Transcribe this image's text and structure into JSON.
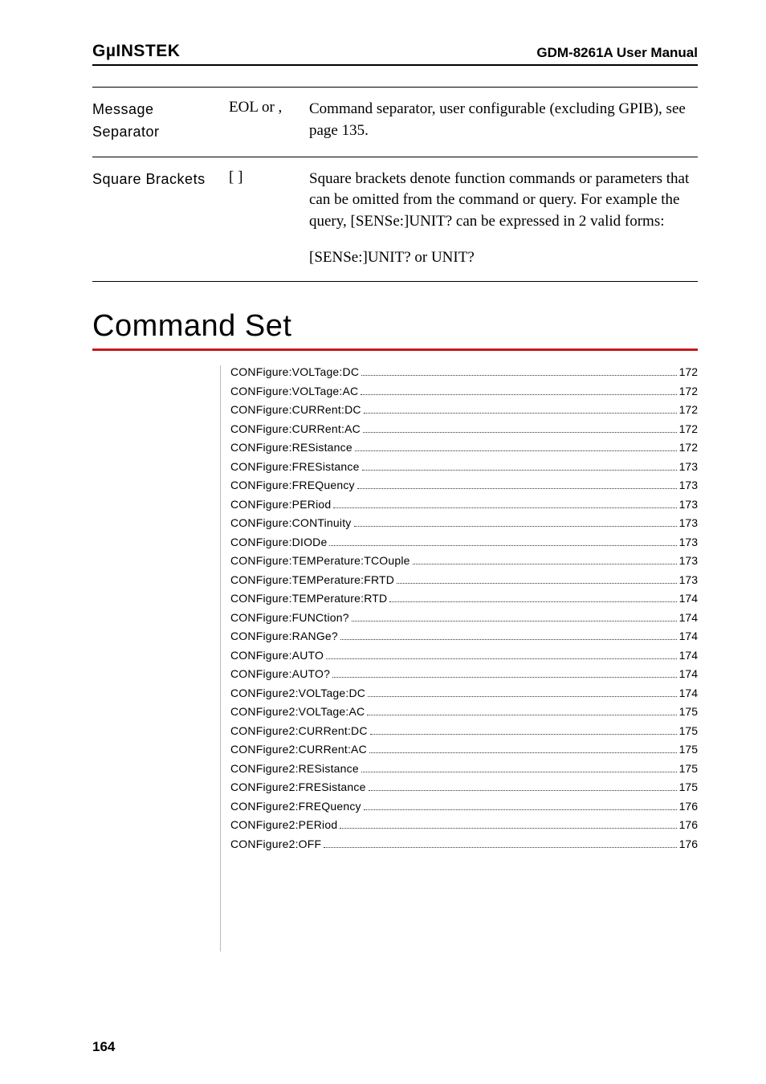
{
  "header": {
    "logo": "GµINSTEK",
    "manual": "GDM-8261A User Manual"
  },
  "def_rows": [
    {
      "label": "Message\nSeparator",
      "symbol": "EOL or ,",
      "desc": [
        "Command separator, user configurable (excluding GPIB), see page 135."
      ]
    },
    {
      "label": "Square Brackets",
      "symbol": "[ ]",
      "desc": [
        "Square brackets denote function commands or parameters that can be omitted from the command or query. For example the query, [SENSe:]UNIT? can be expressed in 2 valid forms:",
        "[SENSe:]UNIT? or UNIT?"
      ]
    }
  ],
  "section_title": "Command Set",
  "toc": [
    {
      "label": "CONFigure:VOLTage:DC",
      "page": "172"
    },
    {
      "label": "CONFigure:VOLTage:AC",
      "page": "172"
    },
    {
      "label": "CONFigure:CURRent:DC",
      "page": "172"
    },
    {
      "label": "CONFigure:CURRent:AC",
      "page": "172"
    },
    {
      "label": "CONFigure:RESistance",
      "page": "172"
    },
    {
      "label": "CONFigure:FRESistance",
      "page": "173"
    },
    {
      "label": "CONFigure:FREQuency",
      "page": "173"
    },
    {
      "label": "CONFigure:PERiod",
      "page": "173"
    },
    {
      "label": "CONFigure:CONTinuity",
      "page": "173"
    },
    {
      "label": "CONFigure:DIODe",
      "page": "173"
    },
    {
      "label": "CONFigure:TEMPerature:TCOuple",
      "page": "173"
    },
    {
      "label": "CONFigure:TEMPerature:FRTD",
      "page": "173"
    },
    {
      "label": "CONFigure:TEMPerature:RTD",
      "page": "174"
    },
    {
      "label": "CONFigure:FUNCtion?",
      "page": "174"
    },
    {
      "label": "CONFigure:RANGe?",
      "page": "174"
    },
    {
      "label": "CONFigure:AUTO",
      "page": "174"
    },
    {
      "label": "CONFigure:AUTO?",
      "page": "174"
    },
    {
      "label": "CONFigure2:VOLTage:DC",
      "page": "174"
    },
    {
      "label": "CONFigure2:VOLTage:AC",
      "page": "175"
    },
    {
      "label": "CONFigure2:CURRent:DC",
      "page": "175"
    },
    {
      "label": "CONFigure2:CURRent:AC",
      "page": "175"
    },
    {
      "label": "CONFigure2:RESistance",
      "page": "175"
    },
    {
      "label": "CONFigure2:FRESistance",
      "page": "175"
    },
    {
      "label": "CONFigure2:FREQuency",
      "page": "176"
    },
    {
      "label": "CONFigure2:PERiod",
      "page": "176"
    },
    {
      "label": "CONFigure2:OFF",
      "page": "176"
    }
  ],
  "page_number": "164"
}
